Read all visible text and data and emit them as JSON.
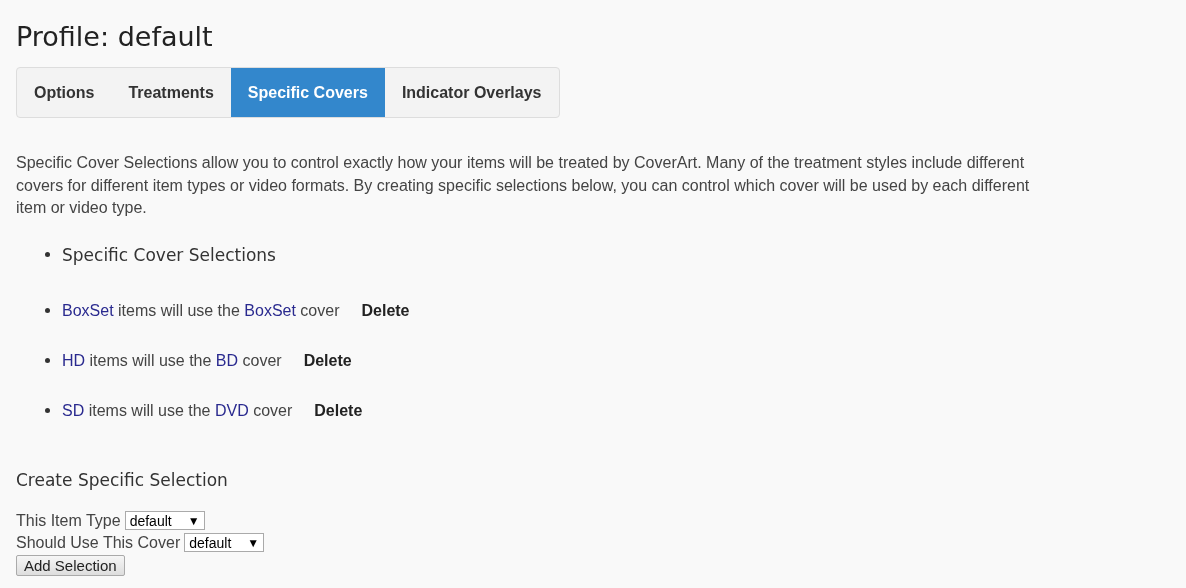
{
  "title": "Profile: default",
  "tabs": [
    {
      "label": "Options",
      "selected": false
    },
    {
      "label": "Treatments",
      "selected": false
    },
    {
      "label": "Specific Covers",
      "selected": true
    },
    {
      "label": "Indicator Overlays",
      "selected": false
    }
  ],
  "description": "Specific Cover Selections allow you to control exactly how your items will be treated by CoverArt. Many of the treatment styles include different covers for different item types or video formats. By creating specific selections below, you can control which cover will be used by each different item or video type.",
  "list_heading": "Specific Cover Selections",
  "selections": [
    {
      "item_type": "BoxSet",
      "middle": "items will use the",
      "cover": "BoxSet",
      "end": "cover",
      "delete": "Delete"
    },
    {
      "item_type": "HD",
      "middle": "items will use the",
      "cover": "BD",
      "end": "cover",
      "delete": "Delete"
    },
    {
      "item_type": "SD",
      "middle": "items will use the",
      "cover": "DVD",
      "end": "cover",
      "delete": "Delete"
    }
  ],
  "create": {
    "heading": "Create Specific Selection",
    "fields": [
      {
        "label": "This Item Type",
        "value": "default",
        "arrow": "▼"
      },
      {
        "label": "Should Use This Cover",
        "value": "default",
        "arrow": "▼"
      }
    ],
    "button": "Add Selection"
  }
}
